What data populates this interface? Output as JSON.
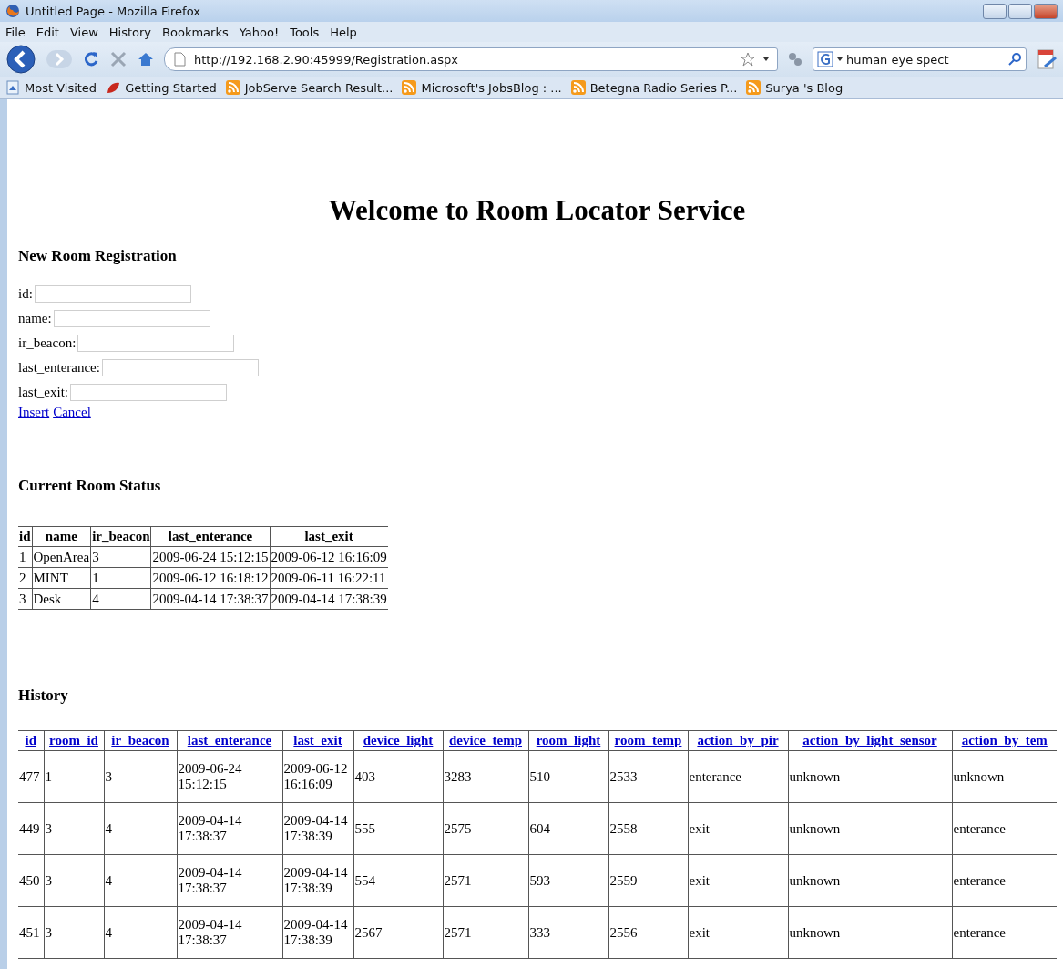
{
  "window": {
    "title": "Untitled Page - Mozilla Firefox"
  },
  "menu": [
    "File",
    "Edit",
    "View",
    "History",
    "Bookmarks",
    "Yahoo!",
    "Tools",
    "Help"
  ],
  "toolbar": {
    "url": "http://192.168.2.90:45999/Registration.aspx",
    "search": "human eye spect"
  },
  "bookmarks": [
    {
      "label": "Most Visited",
      "kind": "folder"
    },
    {
      "label": "Getting Started",
      "kind": "page"
    },
    {
      "label": "JobServe Search Result...",
      "kind": "feed"
    },
    {
      "label": "Microsoft's JobsBlog : ...",
      "kind": "feed"
    },
    {
      "label": "Betegna Radio Series P...",
      "kind": "feed"
    },
    {
      "label": "Surya 's Blog",
      "kind": "feed"
    }
  ],
  "page": {
    "title": "Welcome to Room Locator Service"
  },
  "registration": {
    "heading": "New Room Registration",
    "fields": [
      {
        "label": "id:"
      },
      {
        "label": "name:"
      },
      {
        "label": "ir_beacon:"
      },
      {
        "label": "last_enterance:"
      },
      {
        "label": "last_exit:"
      }
    ],
    "links": [
      "Insert",
      "Cancel"
    ]
  },
  "status": {
    "heading": "Current Room Status",
    "columns": [
      "id",
      "name",
      "ir_beacon",
      "last_enterance",
      "last_exit"
    ],
    "rows": [
      [
        "1",
        "OpenArea",
        "3",
        "2009-06-24 15:12:15",
        "2009-06-12 16:16:09"
      ],
      [
        "2",
        "MINT",
        "1",
        "2009-06-12 16:18:12",
        "2009-06-11 16:22:11"
      ],
      [
        "3",
        "Desk",
        "4",
        "2009-04-14 17:38:37",
        "2009-04-14 17:38:39"
      ]
    ]
  },
  "history": {
    "heading": "History",
    "columns": [
      "id",
      "room_id",
      "ir_beacon",
      "last_enterance",
      "last_exit",
      "device_light",
      "device_temp",
      "room_light",
      "room_temp",
      "action_by_pir",
      "action_by_light_sensor",
      "action_by_tem"
    ],
    "rows": [
      [
        "477",
        "1",
        "3",
        "2009-06-24 15:12:15",
        "2009-06-12 16:16:09",
        "403",
        "3283",
        "510",
        "2533",
        "enterance",
        "unknown",
        "unknown"
      ],
      [
        "449",
        "3",
        "4",
        "2009-04-14 17:38:37",
        "2009-04-14 17:38:39",
        "555",
        "2575",
        "604",
        "2558",
        "exit",
        "unknown",
        "enterance"
      ],
      [
        "450",
        "3",
        "4",
        "2009-04-14 17:38:37",
        "2009-04-14 17:38:39",
        "554",
        "2571",
        "593",
        "2559",
        "exit",
        "unknown",
        "enterance"
      ],
      [
        "451",
        "3",
        "4",
        "2009-04-14 17:38:37",
        "2009-04-14 17:38:39",
        "2567",
        "2571",
        "333",
        "2556",
        "exit",
        "unknown",
        "enterance"
      ]
    ]
  }
}
